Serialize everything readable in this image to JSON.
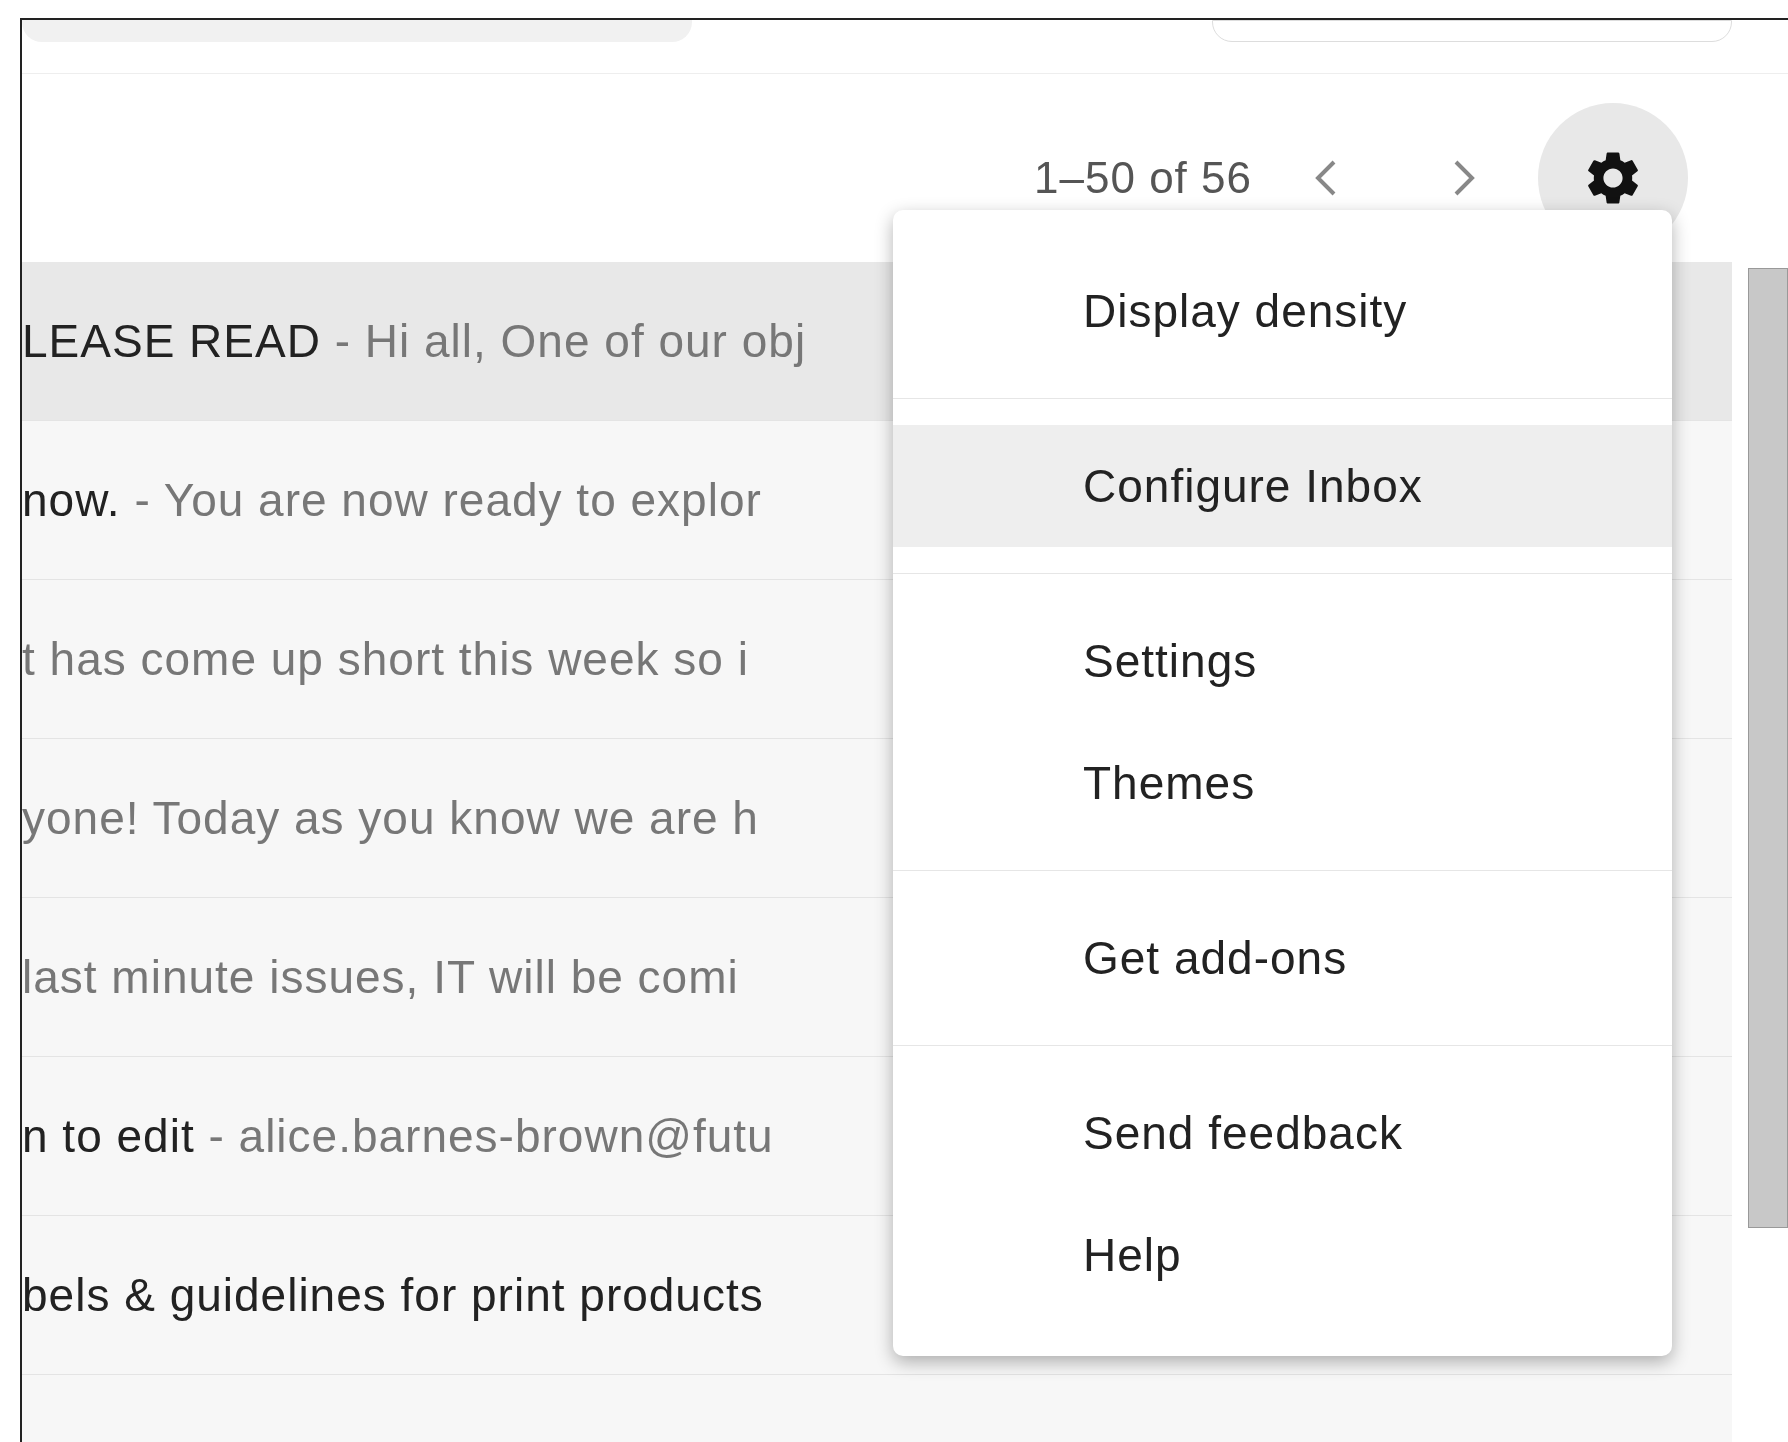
{
  "toolbar": {
    "page_range": "1–50 of 56"
  },
  "messages": [
    {
      "subject": "LEASE READ",
      "snippet": " - Hi all, One of our obj",
      "selected": true
    },
    {
      "subject": "now.",
      "snippet": " - You are now ready to explor",
      "selected": false
    },
    {
      "snippet": "t has come up short this week so i",
      "selected": false
    },
    {
      "snippet": "yone! Today as you know we are h",
      "selected": false
    },
    {
      "snippet": "last minute issues, IT will be comi",
      "selected": false
    },
    {
      "subject": "n to edit",
      "snippet": " - alice.barnes-brown@futu",
      "selected": false
    },
    {
      "subject": "bels & guidelines for print products",
      "selected": false
    }
  ],
  "settings_menu": {
    "groups": [
      [
        {
          "label": "Display density",
          "selected": false
        }
      ],
      [
        {
          "label": "Configure Inbox",
          "selected": true
        }
      ],
      [
        {
          "label": "Settings",
          "selected": false
        },
        {
          "label": "Themes",
          "selected": false
        }
      ],
      [
        {
          "label": "Get add-ons",
          "selected": false
        }
      ],
      [
        {
          "label": "Send feedback",
          "selected": false
        },
        {
          "label": "Help",
          "selected": false
        }
      ]
    ]
  }
}
